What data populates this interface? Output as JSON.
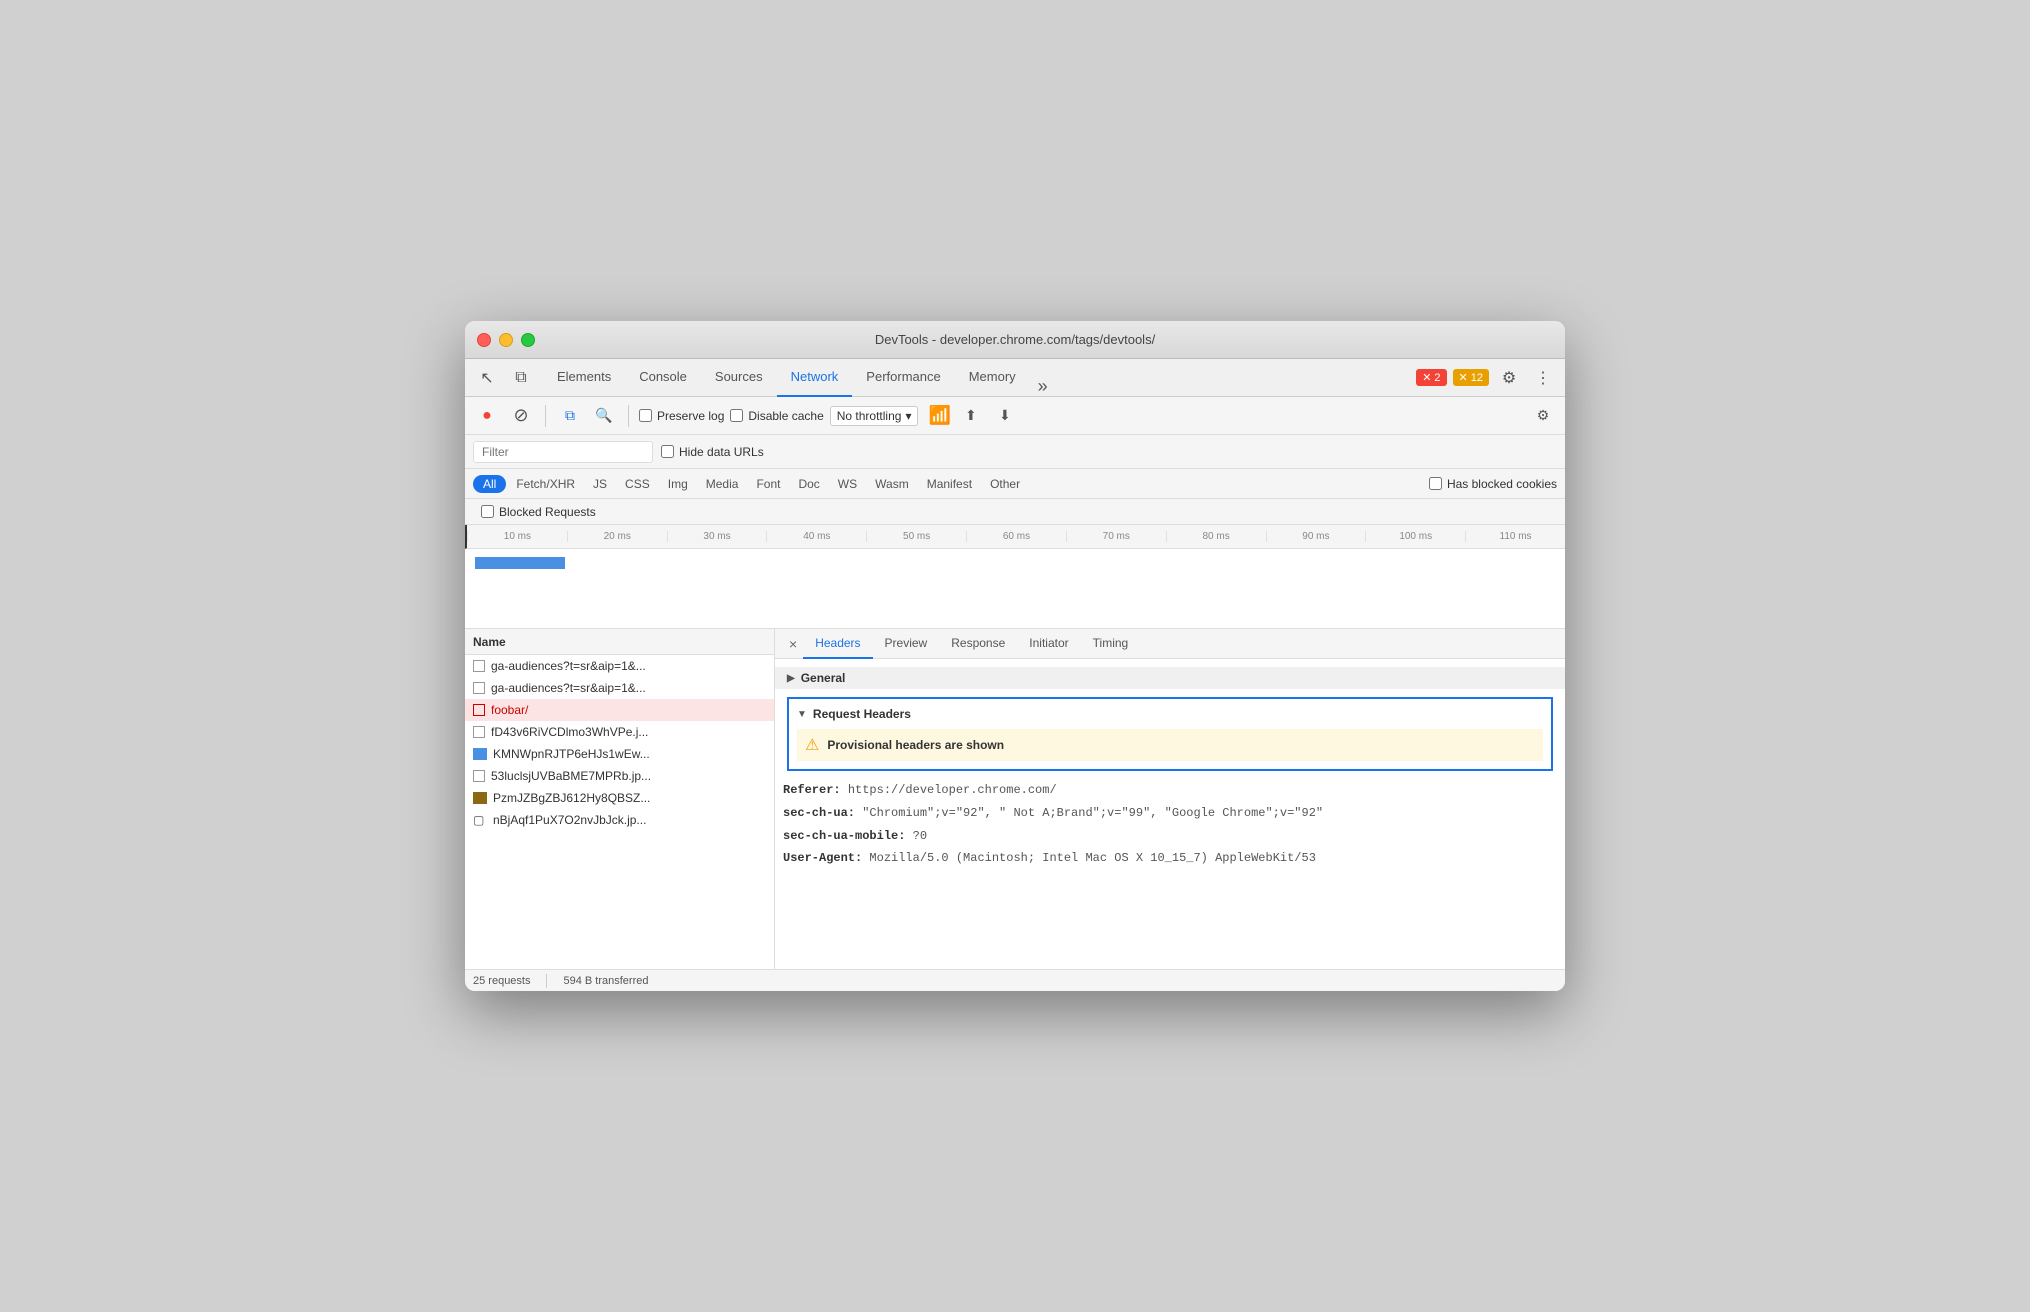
{
  "window": {
    "title": "DevTools - developer.chrome.com/tags/devtools/"
  },
  "titlebar": {
    "title": "DevTools - developer.chrome.com/tags/devtools/"
  },
  "devtools_tabs": {
    "tabs": [
      {
        "label": "Elements",
        "active": false
      },
      {
        "label": "Console",
        "active": false
      },
      {
        "label": "Sources",
        "active": false
      },
      {
        "label": "Network",
        "active": true
      },
      {
        "label": "Performance",
        "active": false
      },
      {
        "label": "Memory",
        "active": false
      }
    ],
    "more_label": "»",
    "error_count": "2",
    "warning_count": "12",
    "settings_icon": "⚙",
    "more_options_icon": "⋮"
  },
  "toolbar": {
    "record_label": "●",
    "stop_label": "⊘",
    "clear_label": "🗑",
    "search_label": "🔍",
    "preserve_log_label": "Preserve log",
    "disable_cache_label": "Disable cache",
    "throttle_label": "No throttling",
    "throttle_arrow": "▾",
    "upload_icon": "⬆",
    "download_icon": "⬇",
    "settings_icon": "⚙"
  },
  "filter_bar": {
    "filter_placeholder": "Filter",
    "hide_data_urls_label": "Hide data URLs"
  },
  "filter_types": [
    {
      "label": "All",
      "active": true
    },
    {
      "label": "Fetch/XHR",
      "active": false
    },
    {
      "label": "JS",
      "active": false
    },
    {
      "label": "CSS",
      "active": false
    },
    {
      "label": "Img",
      "active": false
    },
    {
      "label": "Media",
      "active": false
    },
    {
      "label": "Font",
      "active": false
    },
    {
      "label": "Doc",
      "active": false
    },
    {
      "label": "WS",
      "active": false
    },
    {
      "label": "Wasm",
      "active": false
    },
    {
      "label": "Manifest",
      "active": false
    },
    {
      "label": "Other",
      "active": false
    }
  ],
  "blocked_requests_label": "Blocked Requests",
  "has_blocked_cookies_label": "Has blocked cookies",
  "timeline_ticks": [
    "10 ms",
    "20 ms",
    "30 ms",
    "40 ms",
    "50 ms",
    "60 ms",
    "70 ms",
    "80 ms",
    "90 ms",
    "100 ms",
    "110 ms"
  ],
  "file_list": {
    "header": "Name",
    "items": [
      {
        "name": "ga-audiences?t=sr&aip=1&...",
        "selected": false,
        "type": "checkbox"
      },
      {
        "name": "ga-audiences?t=sr&aip=1&...",
        "selected": false,
        "type": "checkbox"
      },
      {
        "name": "foobar/",
        "selected": true,
        "type": "checkbox"
      },
      {
        "name": "fD43v6RiVCDlmo3WhVPe.j...",
        "selected": false,
        "type": "checkbox"
      },
      {
        "name": "KMNWpnRJTP6eHJs1wEw...",
        "selected": false,
        "type": "image"
      },
      {
        "name": "53luclsjUVBaBME7MPRb.jp...",
        "selected": false,
        "type": "checkbox"
      },
      {
        "name": "PzmJZBgZBJ612Hy8QBSZ...",
        "selected": false,
        "type": "image-brown"
      },
      {
        "name": "nBjAqf1PuX7O2nvJbJck.jp...",
        "selected": false,
        "type": "dash"
      }
    ]
  },
  "detail_panel": {
    "close_icon": "×",
    "tabs": [
      {
        "label": "Headers",
        "active": true
      },
      {
        "label": "Preview",
        "active": false
      },
      {
        "label": "Response",
        "active": false
      },
      {
        "label": "Initiator",
        "active": false
      },
      {
        "label": "Timing",
        "active": false
      }
    ],
    "general_section": "General",
    "request_headers_section": "Request Headers",
    "provisional_warning": "Provisional headers are shown",
    "headers": [
      {
        "name": "Referer:",
        "value": "https://developer.chrome.com/"
      },
      {
        "name": "sec-ch-ua:",
        "value": "\"Chromium\";v=\"92\", \" Not A;Brand\";v=\"99\", \"Google Chrome\";v=\"92\""
      },
      {
        "name": "sec-ch-ua-mobile:",
        "value": "?0"
      },
      {
        "name": "User-Agent:",
        "value": "Mozilla/5.0 (Macintosh; Intel Mac OS X 10_15_7) AppleWebKit/53"
      }
    ]
  },
  "status_bar": {
    "requests": "25 requests",
    "transferred": "594 B transferred"
  }
}
